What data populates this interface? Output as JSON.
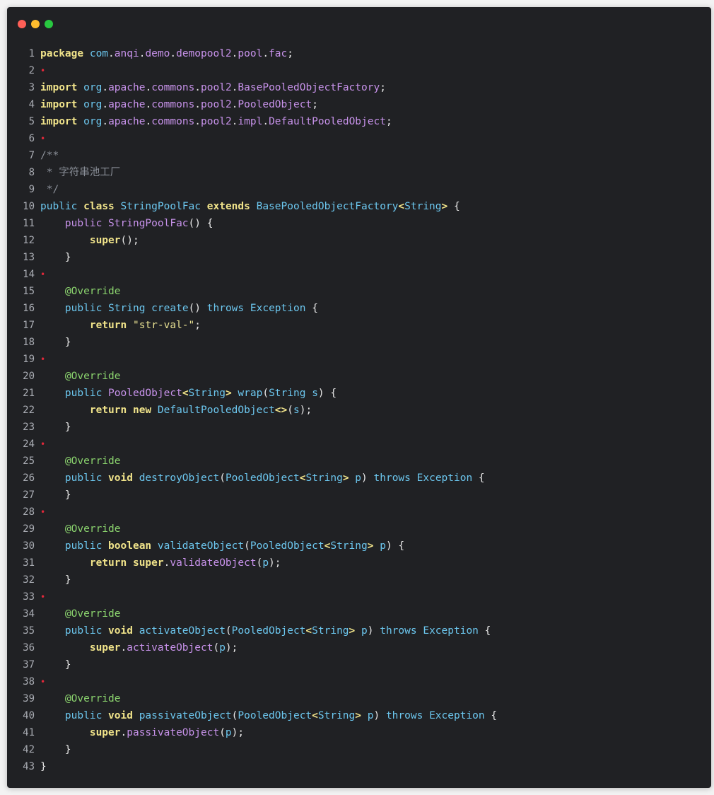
{
  "window": {
    "controls": [
      "close",
      "minimize",
      "maximize"
    ]
  },
  "code": {
    "lines": [
      {
        "n": "1",
        "tokens": [
          [
            "kw",
            "package"
          ],
          [
            "pun",
            " "
          ],
          [
            "type",
            "com"
          ],
          [
            "pun",
            "."
          ],
          [
            "pkg",
            "anqi"
          ],
          [
            "pun",
            "."
          ],
          [
            "pkg",
            "demo"
          ],
          [
            "pun",
            "."
          ],
          [
            "pkg",
            "demopool2"
          ],
          [
            "pun",
            "."
          ],
          [
            "pkg",
            "pool"
          ],
          [
            "pun",
            "."
          ],
          [
            "pkg",
            "fac"
          ],
          [
            "pun",
            ";"
          ]
        ]
      },
      {
        "n": "2",
        "tokens": [
          [
            "blank-dot",
            "•"
          ]
        ]
      },
      {
        "n": "3",
        "tokens": [
          [
            "kw",
            "import"
          ],
          [
            "pun",
            " "
          ],
          [
            "type",
            "org"
          ],
          [
            "pun",
            "."
          ],
          [
            "pkg",
            "apache"
          ],
          [
            "pun",
            "."
          ],
          [
            "pkg",
            "commons"
          ],
          [
            "pun",
            "."
          ],
          [
            "pkg",
            "pool2"
          ],
          [
            "pun",
            "."
          ],
          [
            "pkg",
            "BasePooledObjectFactory"
          ],
          [
            "pun",
            ";"
          ]
        ]
      },
      {
        "n": "4",
        "tokens": [
          [
            "kw",
            "import"
          ],
          [
            "pun",
            " "
          ],
          [
            "type",
            "org"
          ],
          [
            "pun",
            "."
          ],
          [
            "pkg",
            "apache"
          ],
          [
            "pun",
            "."
          ],
          [
            "pkg",
            "commons"
          ],
          [
            "pun",
            "."
          ],
          [
            "pkg",
            "pool2"
          ],
          [
            "pun",
            "."
          ],
          [
            "pkg",
            "PooledObject"
          ],
          [
            "pun",
            ";"
          ]
        ]
      },
      {
        "n": "5",
        "tokens": [
          [
            "kw",
            "import"
          ],
          [
            "pun",
            " "
          ],
          [
            "type",
            "org"
          ],
          [
            "pun",
            "."
          ],
          [
            "pkg",
            "apache"
          ],
          [
            "pun",
            "."
          ],
          [
            "pkg",
            "commons"
          ],
          [
            "pun",
            "."
          ],
          [
            "pkg",
            "pool2"
          ],
          [
            "pun",
            "."
          ],
          [
            "pkg",
            "impl"
          ],
          [
            "pun",
            "."
          ],
          [
            "pkg",
            "DefaultPooledObject"
          ],
          [
            "pun",
            ";"
          ]
        ]
      },
      {
        "n": "6",
        "tokens": [
          [
            "blank-dot",
            "•"
          ]
        ]
      },
      {
        "n": "7",
        "tokens": [
          [
            "cmt",
            "/**"
          ]
        ]
      },
      {
        "n": "8",
        "tokens": [
          [
            "cmt",
            " * 字符串池工厂"
          ]
        ]
      },
      {
        "n": "9",
        "tokens": [
          [
            "cmt",
            " */"
          ]
        ]
      },
      {
        "n": "10",
        "tokens": [
          [
            "type",
            "public"
          ],
          [
            "pun",
            " "
          ],
          [
            "kw",
            "class"
          ],
          [
            "pun",
            " "
          ],
          [
            "cls",
            "StringPoolFac"
          ],
          [
            "pun",
            " "
          ],
          [
            "kw",
            "extends"
          ],
          [
            "pun",
            " "
          ],
          [
            "cls",
            "BasePooledObjectFactory"
          ],
          [
            "kw",
            "<"
          ],
          [
            "cls",
            "String"
          ],
          [
            "kw",
            ">"
          ],
          [
            "pun",
            " {"
          ]
        ]
      },
      {
        "n": "11",
        "tokens": [
          [
            "pun",
            "    "
          ],
          [
            "pkg",
            "public"
          ],
          [
            "pun",
            " "
          ],
          [
            "fn",
            "StringPoolFac"
          ],
          [
            "pun",
            "() {"
          ]
        ]
      },
      {
        "n": "12",
        "tokens": [
          [
            "pun",
            "        "
          ],
          [
            "kw",
            "super"
          ],
          [
            "pun",
            "();"
          ]
        ]
      },
      {
        "n": "13",
        "tokens": [
          [
            "pun",
            "    }"
          ]
        ]
      },
      {
        "n": "14",
        "tokens": [
          [
            "blank-dot",
            "•"
          ]
        ]
      },
      {
        "n": "15",
        "tokens": [
          [
            "pun",
            "    "
          ],
          [
            "ann",
            "@Override"
          ]
        ]
      },
      {
        "n": "16",
        "tokens": [
          [
            "pun",
            "    "
          ],
          [
            "type",
            "public"
          ],
          [
            "pun",
            " "
          ],
          [
            "cls",
            "String"
          ],
          [
            "pun",
            " "
          ],
          [
            "cls",
            "create"
          ],
          [
            "pun",
            "() "
          ],
          [
            "type",
            "throws"
          ],
          [
            "pun",
            " "
          ],
          [
            "cls",
            "Exception"
          ],
          [
            "pun",
            " {"
          ]
        ]
      },
      {
        "n": "17",
        "tokens": [
          [
            "pun",
            "        "
          ],
          [
            "kw",
            "return"
          ],
          [
            "pun",
            " "
          ],
          [
            "str",
            "\"str-val-\""
          ],
          [
            "pun",
            ";"
          ]
        ]
      },
      {
        "n": "18",
        "tokens": [
          [
            "pun",
            "    }"
          ]
        ]
      },
      {
        "n": "19",
        "tokens": [
          [
            "blank-dot",
            "•"
          ]
        ]
      },
      {
        "n": "20",
        "tokens": [
          [
            "pun",
            "    "
          ],
          [
            "ann",
            "@Override"
          ]
        ]
      },
      {
        "n": "21",
        "tokens": [
          [
            "pun",
            "    "
          ],
          [
            "type",
            "public"
          ],
          [
            "pun",
            " "
          ],
          [
            "fn",
            "PooledObject"
          ],
          [
            "kw",
            "<"
          ],
          [
            "cls",
            "String"
          ],
          [
            "kw",
            ">"
          ],
          [
            "pun",
            " "
          ],
          [
            "cls",
            "wrap"
          ],
          [
            "pun",
            "("
          ],
          [
            "cls",
            "String"
          ],
          [
            "pun",
            " "
          ],
          [
            "prm",
            "s"
          ],
          [
            "pun",
            ") {"
          ]
        ]
      },
      {
        "n": "22",
        "tokens": [
          [
            "pun",
            "        "
          ],
          [
            "kw",
            "return"
          ],
          [
            "pun",
            " "
          ],
          [
            "kw",
            "new"
          ],
          [
            "pun",
            " "
          ],
          [
            "cls",
            "DefaultPooledObject"
          ],
          [
            "kw",
            "<>"
          ],
          [
            "pun",
            "("
          ],
          [
            "prm",
            "s"
          ],
          [
            "pun",
            ");"
          ]
        ]
      },
      {
        "n": "23",
        "tokens": [
          [
            "pun",
            "    }"
          ]
        ]
      },
      {
        "n": "24",
        "tokens": [
          [
            "blank-dot",
            "•"
          ]
        ]
      },
      {
        "n": "25",
        "tokens": [
          [
            "pun",
            "    "
          ],
          [
            "ann",
            "@Override"
          ]
        ]
      },
      {
        "n": "26",
        "tokens": [
          [
            "pun",
            "    "
          ],
          [
            "type",
            "public"
          ],
          [
            "pun",
            " "
          ],
          [
            "kw",
            "void"
          ],
          [
            "pun",
            " "
          ],
          [
            "cls",
            "destroyObject"
          ],
          [
            "pun",
            "("
          ],
          [
            "cls",
            "PooledObject"
          ],
          [
            "kw",
            "<"
          ],
          [
            "cls",
            "String"
          ],
          [
            "kw",
            ">"
          ],
          [
            "pun",
            " "
          ],
          [
            "prm",
            "p"
          ],
          [
            "pun",
            ") "
          ],
          [
            "type",
            "throws"
          ],
          [
            "pun",
            " "
          ],
          [
            "cls",
            "Exception"
          ],
          [
            "pun",
            " {"
          ]
        ]
      },
      {
        "n": "27",
        "tokens": [
          [
            "pun",
            "    }"
          ]
        ]
      },
      {
        "n": "28",
        "tokens": [
          [
            "blank-dot",
            "•"
          ]
        ]
      },
      {
        "n": "29",
        "tokens": [
          [
            "pun",
            "    "
          ],
          [
            "ann",
            "@Override"
          ]
        ]
      },
      {
        "n": "30",
        "tokens": [
          [
            "pun",
            "    "
          ],
          [
            "type",
            "public"
          ],
          [
            "pun",
            " "
          ],
          [
            "kw",
            "boolean"
          ],
          [
            "pun",
            " "
          ],
          [
            "cls",
            "validateObject"
          ],
          [
            "pun",
            "("
          ],
          [
            "cls",
            "PooledObject"
          ],
          [
            "kw",
            "<"
          ],
          [
            "cls",
            "String"
          ],
          [
            "kw",
            ">"
          ],
          [
            "pun",
            " "
          ],
          [
            "prm",
            "p"
          ],
          [
            "pun",
            ") {"
          ]
        ]
      },
      {
        "n": "31",
        "tokens": [
          [
            "pun",
            "        "
          ],
          [
            "kw",
            "return"
          ],
          [
            "pun",
            " "
          ],
          [
            "kw",
            "super"
          ],
          [
            "pun",
            "."
          ],
          [
            "fn",
            "validateObject"
          ],
          [
            "pun",
            "("
          ],
          [
            "prm",
            "p"
          ],
          [
            "pun",
            ");"
          ]
        ]
      },
      {
        "n": "32",
        "tokens": [
          [
            "pun",
            "    }"
          ]
        ]
      },
      {
        "n": "33",
        "tokens": [
          [
            "blank-dot",
            "•"
          ]
        ]
      },
      {
        "n": "34",
        "tokens": [
          [
            "pun",
            "    "
          ],
          [
            "ann",
            "@Override"
          ]
        ]
      },
      {
        "n": "35",
        "tokens": [
          [
            "pun",
            "    "
          ],
          [
            "type",
            "public"
          ],
          [
            "pun",
            " "
          ],
          [
            "kw",
            "void"
          ],
          [
            "pun",
            " "
          ],
          [
            "cls",
            "activateObject"
          ],
          [
            "pun",
            "("
          ],
          [
            "cls",
            "PooledObject"
          ],
          [
            "kw",
            "<"
          ],
          [
            "cls",
            "String"
          ],
          [
            "kw",
            ">"
          ],
          [
            "pun",
            " "
          ],
          [
            "prm",
            "p"
          ],
          [
            "pun",
            ") "
          ],
          [
            "type",
            "throws"
          ],
          [
            "pun",
            " "
          ],
          [
            "cls",
            "Exception"
          ],
          [
            "pun",
            " {"
          ]
        ]
      },
      {
        "n": "36",
        "tokens": [
          [
            "pun",
            "        "
          ],
          [
            "kw",
            "super"
          ],
          [
            "pun",
            "."
          ],
          [
            "fn",
            "activateObject"
          ],
          [
            "pun",
            "("
          ],
          [
            "prm",
            "p"
          ],
          [
            "pun",
            ");"
          ]
        ]
      },
      {
        "n": "37",
        "tokens": [
          [
            "pun",
            "    }"
          ]
        ]
      },
      {
        "n": "38",
        "tokens": [
          [
            "blank-dot",
            "•"
          ]
        ]
      },
      {
        "n": "39",
        "tokens": [
          [
            "pun",
            "    "
          ],
          [
            "ann",
            "@Override"
          ]
        ]
      },
      {
        "n": "40",
        "tokens": [
          [
            "pun",
            "    "
          ],
          [
            "type",
            "public"
          ],
          [
            "pun",
            " "
          ],
          [
            "kw",
            "void"
          ],
          [
            "pun",
            " "
          ],
          [
            "cls",
            "passivateObject"
          ],
          [
            "pun",
            "("
          ],
          [
            "cls",
            "PooledObject"
          ],
          [
            "kw",
            "<"
          ],
          [
            "cls",
            "String"
          ],
          [
            "kw",
            ">"
          ],
          [
            "pun",
            " "
          ],
          [
            "prm",
            "p"
          ],
          [
            "pun",
            ") "
          ],
          [
            "type",
            "throws"
          ],
          [
            "pun",
            " "
          ],
          [
            "cls",
            "Exception"
          ],
          [
            "pun",
            " {"
          ]
        ]
      },
      {
        "n": "41",
        "tokens": [
          [
            "pun",
            "        "
          ],
          [
            "kw",
            "super"
          ],
          [
            "pun",
            "."
          ],
          [
            "fn",
            "passivateObject"
          ],
          [
            "pun",
            "("
          ],
          [
            "prm",
            "p"
          ],
          [
            "pun",
            ");"
          ]
        ]
      },
      {
        "n": "42",
        "tokens": [
          [
            "pun",
            "    }"
          ]
        ]
      },
      {
        "n": "43",
        "tokens": [
          [
            "pun",
            "}"
          ]
        ]
      }
    ]
  }
}
